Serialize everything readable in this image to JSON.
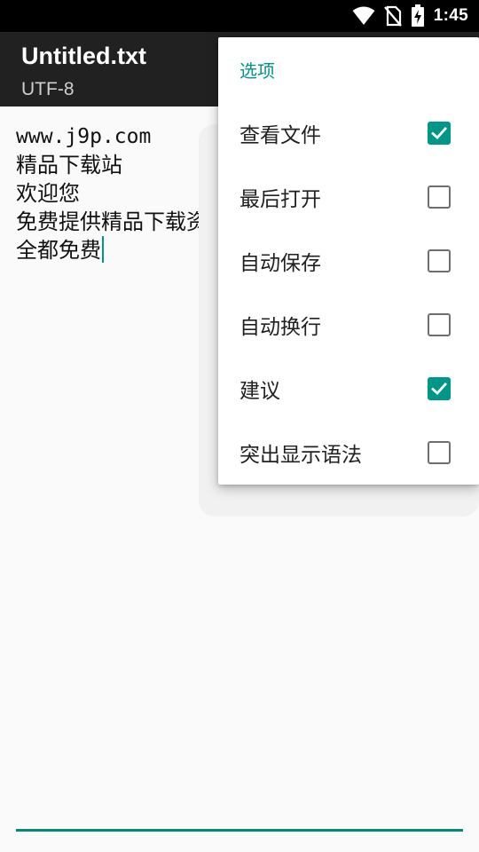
{
  "status_bar": {
    "time": "1:45",
    "icons": [
      "wifi-icon",
      "no-sim-icon",
      "battery-charging-icon"
    ]
  },
  "app_bar": {
    "title": "Untitled.txt",
    "subtitle": "UTF-8"
  },
  "editor": {
    "lines": [
      "www.j9p.com",
      "精品下载站",
      "欢迎您",
      "免费提供精品下载资",
      "全都免费"
    ]
  },
  "menu": {
    "header": "选项",
    "items": [
      {
        "label": "查看文件",
        "checked": true
      },
      {
        "label": "最后打开",
        "checked": false
      },
      {
        "label": "自动保存",
        "checked": false
      },
      {
        "label": "自动换行",
        "checked": false
      },
      {
        "label": "建议",
        "checked": true
      },
      {
        "label": "突出显示语法",
        "checked": false
      }
    ]
  },
  "colors": {
    "accent": "#009688",
    "app_bar": "#212121",
    "status_bar": "#000000",
    "background": "#fafafa"
  }
}
